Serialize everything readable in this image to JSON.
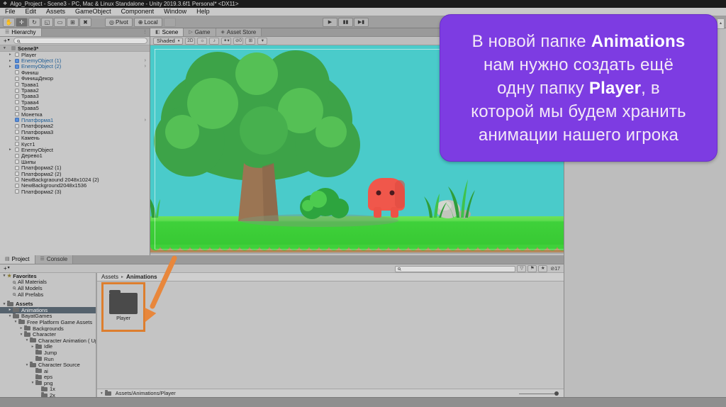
{
  "window": {
    "title": "Algo_Project - Scene3 - PC, Mac & Linux Standalone - Unity 2019.3.6f1 Personal* <DX11>"
  },
  "menu": {
    "items": [
      "File",
      "Edit",
      "Assets",
      "GameObject",
      "Component",
      "Window",
      "Help"
    ]
  },
  "toolbar": {
    "tools": [
      "hand",
      "move",
      "rotate",
      "scale",
      "rect",
      "transform",
      "custom"
    ],
    "active_tool": "move",
    "pivot_label": "Pivot",
    "local_label": "Local"
  },
  "hierarchy": {
    "tab_label": "Hierarchy",
    "scene_label": "Scene3*",
    "items": [
      {
        "label": "Player",
        "arrow": true
      },
      {
        "label": "EnemyObject (1)",
        "arrow": true,
        "prefab": true,
        "more": true
      },
      {
        "label": "EnemyObject (2)",
        "arrow": true,
        "prefab": true,
        "more": true
      },
      {
        "label": "Финиш"
      },
      {
        "label": "ФинишДекор"
      },
      {
        "label": "Трава1"
      },
      {
        "label": "Трава2"
      },
      {
        "label": "Трава3"
      },
      {
        "label": "Трава4"
      },
      {
        "label": "Трава5"
      },
      {
        "label": "Монетка"
      },
      {
        "label": "Платформа1",
        "prefab": true,
        "more": true
      },
      {
        "label": "Платформа2"
      },
      {
        "label": "Платформа3"
      },
      {
        "label": "Камень"
      },
      {
        "label": "Куст1"
      },
      {
        "label": "EnemyObject",
        "arrow": true
      },
      {
        "label": "Дерево1"
      },
      {
        "label": "Шипы"
      },
      {
        "label": "Платформа2 (1)"
      },
      {
        "label": "Платформа2 (2)"
      },
      {
        "label": "NewBackgraound 2048x1024 (2)"
      },
      {
        "label": "NewBackground2048x1536"
      },
      {
        "label": "Платформа2 (3)"
      }
    ]
  },
  "scene_view": {
    "tabs": [
      {
        "label": "Scene",
        "active": true
      },
      {
        "label": "Game",
        "active": false
      },
      {
        "label": "Asset Store",
        "active": false
      }
    ],
    "shading_mode": "Shaded",
    "mode_2d": "2D",
    "hidden_count": "0"
  },
  "project": {
    "tabs": [
      {
        "label": "Project",
        "active": true
      },
      {
        "label": "Console",
        "active": false
      }
    ],
    "hidden_count": "17",
    "tree": [
      {
        "label": "Favorites",
        "icon": "star",
        "arrow": "open",
        "bold": true,
        "indent": 0
      },
      {
        "label": "All Materials",
        "icon": "search",
        "indent": 1
      },
      {
        "label": "All Models",
        "icon": "search",
        "indent": 1
      },
      {
        "label": "All Prefabs",
        "icon": "search",
        "indent": 1
      },
      {
        "spacer": true
      },
      {
        "label": "Assets",
        "icon": "folder",
        "arrow": "open",
        "bold": true,
        "indent": 0
      },
      {
        "label": "Animations",
        "icon": "folder",
        "arrow": "closed",
        "indent": 1,
        "selected": true
      },
      {
        "label": "BayatGames",
        "icon": "folder",
        "arrow": "open",
        "indent": 1
      },
      {
        "label": "Free Platform Game Assets",
        "icon": "folder",
        "arrow": "open",
        "indent": 2
      },
      {
        "label": "Backgrounds",
        "icon": "folder",
        "arrow": "closed",
        "indent": 3
      },
      {
        "label": "Character",
        "icon": "folder",
        "arrow": "open",
        "indent": 3
      },
      {
        "label": "Character Animation ( Updat",
        "icon": "folder",
        "arrow": "open",
        "indent": 4
      },
      {
        "label": "Idle",
        "icon": "folder",
        "arrow": "closed",
        "indent": 5
      },
      {
        "label": "Jump",
        "icon": "folder",
        "indent": 5
      },
      {
        "label": "Run",
        "icon": "folder",
        "indent": 5
      },
      {
        "label": "Character Source",
        "icon": "folder",
        "arrow": "open",
        "indent": 4
      },
      {
        "label": "ai",
        "icon": "folder",
        "indent": 5
      },
      {
        "label": "eps",
        "icon": "folder",
        "indent": 5
      },
      {
        "label": "png",
        "icon": "folder",
        "arrow": "open",
        "indent": 5
      },
      {
        "label": "1x",
        "icon": "folder",
        "indent": 6
      },
      {
        "label": "2x",
        "icon": "folder",
        "indent": 6
      }
    ],
    "breadcrumb": {
      "root": "Assets",
      "current": "Animations"
    },
    "folder_item_label": "Player",
    "status_path": "Assets/Animations/Player"
  },
  "tooltip": {
    "lines": [
      [
        {
          "t": "В новой папке "
        },
        {
          "t": "Animations",
          "b": true
        }
      ],
      [
        {
          "t": "нам нужно создать ещё"
        }
      ],
      [
        {
          "t": "одну папку "
        },
        {
          "t": "Player",
          "b": true
        },
        {
          "t": ", в"
        }
      ],
      [
        {
          "t": "которой мы будем хранить"
        }
      ],
      [
        {
          "t": "анимации нашего игрока"
        }
      ]
    ]
  },
  "colors": {
    "tooltip_bg": "#7d3ce2",
    "highlight_orange": "#dd7e2e",
    "sky": "#4acbca",
    "prefab_text": "#1d5c94"
  }
}
